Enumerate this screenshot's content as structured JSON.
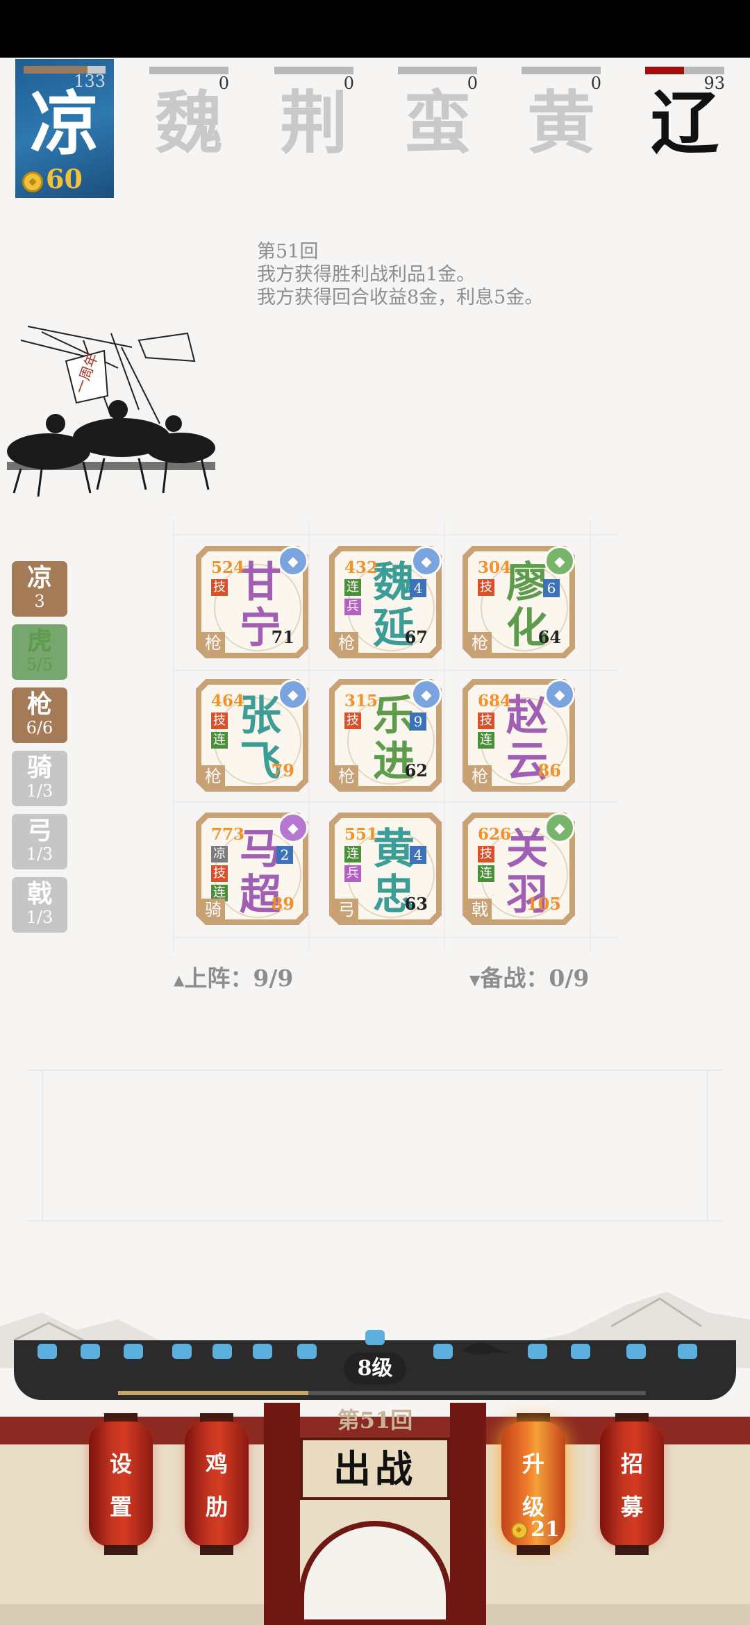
{
  "player": {
    "faction": "凉",
    "hp": "133",
    "hp_fraction": 0.78,
    "gold": "60"
  },
  "factions": [
    {
      "name": "魏",
      "hp": "0",
      "hp_fraction": 0,
      "active": false
    },
    {
      "name": "荆",
      "hp": "0",
      "hp_fraction": 0,
      "active": false
    },
    {
      "name": "蛮",
      "hp": "0",
      "hp_fraction": 0,
      "active": false
    },
    {
      "name": "黄",
      "hp": "0",
      "hp_fraction": 0,
      "active": false
    },
    {
      "name": "辽",
      "hp": "93",
      "hp_fraction": 0.49,
      "active": true
    }
  ],
  "log": {
    "round": "第51回",
    "line1": "我方获得胜利战利品1金。",
    "line2": "我方获得回合收益8金，利息5金。"
  },
  "ink_banner_text": "一周年",
  "side_tabs": [
    {
      "label": "凉",
      "count": "3",
      "style": "brown"
    },
    {
      "label": "虎",
      "count": "5/5",
      "style": "green"
    },
    {
      "label": "枪",
      "count": "6/6",
      "style": "brown"
    },
    {
      "label": "骑",
      "count": "1/3",
      "style": "gray"
    },
    {
      "label": "弓",
      "count": "1/3",
      "style": "gray"
    },
    {
      "label": "戟",
      "count": "1/3",
      "style": "gray"
    }
  ],
  "cards": [
    {
      "name1": "甘",
      "name2": "宁",
      "cost": "524",
      "tags": [
        "技"
      ],
      "num": "",
      "type": "枪",
      "level": "71",
      "color": "purple",
      "badge_color": "blue",
      "badge_icon": "shield-icon"
    },
    {
      "name1": "魏",
      "name2": "延",
      "cost": "432",
      "tags": [
        "连",
        "兵"
      ],
      "num": "4",
      "type": "枪",
      "level": "67",
      "color": "teal",
      "badge_color": "blue",
      "badge_icon": "feather-icon"
    },
    {
      "name1": "廖",
      "name2": "化",
      "cost": "304",
      "tags": [
        "技"
      ],
      "num": "6",
      "type": "枪",
      "level": "64",
      "color": "green",
      "badge_color": "green",
      "badge_icon": "bird-icon"
    },
    {
      "name1": "张",
      "name2": "飞",
      "cost": "464",
      "tags": [
        "技",
        "连"
      ],
      "num": "",
      "type": "枪",
      "level": "79",
      "color": "teal",
      "badge_color": "blue",
      "badge_icon": "scroll-icon"
    },
    {
      "name1": "乐",
      "name2": "进",
      "cost": "315",
      "tags": [
        "技"
      ],
      "num": "9",
      "type": "枪",
      "level": "62",
      "color": "green",
      "badge_color": "blue",
      "badge_icon": "book-icon"
    },
    {
      "name1": "赵",
      "name2": "云",
      "cost": "684",
      "tags": [
        "技",
        "连"
      ],
      "num": "",
      "type": "枪",
      "level": "86",
      "color": "purple",
      "badge_color": "blue",
      "badge_icon": "horse-icon"
    },
    {
      "name1": "马",
      "name2": "超",
      "cost": "773",
      "tags": [
        "凉",
        "技",
        "连"
      ],
      "num": "2",
      "type": "骑",
      "level": "89",
      "color": "purple",
      "badge_color": "purple",
      "badge_icon": "helmet-icon"
    },
    {
      "name1": "黄",
      "name2": "忠",
      "cost": "551",
      "tags": [
        "连",
        "兵"
      ],
      "num": "4",
      "type": "弓",
      "level": "63",
      "color": "teal",
      "badge_color": "",
      "badge_icon": ""
    },
    {
      "name1": "关",
      "name2": "羽",
      "cost": "626",
      "tags": [
        "技",
        "连"
      ],
      "num": "",
      "type": "戟",
      "level": "105",
      "color": "purple",
      "badge_color": "green",
      "badge_icon": "blade-icon"
    }
  ],
  "board": {
    "deploy_label": "上阵：9/9",
    "reserve_label": "备战：0/9"
  },
  "bottom": {
    "level_label": "8级",
    "xp_fraction": 0.36,
    "round_label": "第51回",
    "fight_label": "出战",
    "settings_label": "设置",
    "chicken_label": "鸡肋",
    "upgrade_label": "升级",
    "upgrade_cost": "21",
    "recruit_label": "招募"
  }
}
